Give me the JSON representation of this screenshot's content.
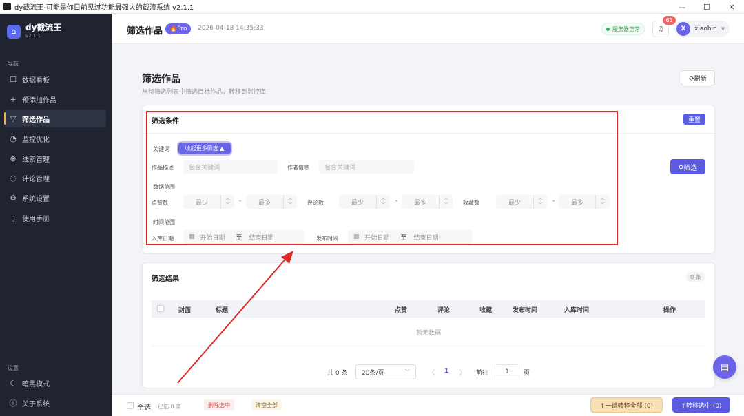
{
  "window": {
    "title": "dy截流王-可能是你目前见过功能最强大的截流系统 v2.1.1",
    "minimize": "—",
    "maximize": "☐",
    "close": "✕"
  },
  "brand": {
    "name": "dy截流王",
    "version": "v2.1.1"
  },
  "sidebar": {
    "nav_label": "导航",
    "items": [
      {
        "label": "数据看板",
        "icon": "chart-icon"
      },
      {
        "label": "预添加作品",
        "icon": "plus-icon"
      },
      {
        "label": "筛选作品",
        "icon": "filter-icon",
        "active": true
      },
      {
        "label": "监控优化",
        "icon": "monitor-icon"
      },
      {
        "label": "线索管理",
        "icon": "target-icon"
      },
      {
        "label": "评论管理",
        "icon": "comment-icon"
      },
      {
        "label": "系统设置",
        "icon": "gear-icon"
      },
      {
        "label": "使用手册",
        "icon": "book-icon"
      }
    ],
    "settings_label": "设置",
    "bottom_items": [
      {
        "label": "暗黑模式",
        "icon": "moon-icon"
      },
      {
        "label": "关于系统",
        "icon": "info-icon"
      }
    ]
  },
  "header": {
    "title": "筛选作品",
    "badge": "🔥Pro",
    "datetime": "2026-04-18 14:35:33",
    "server_status": "服务器正常",
    "notifications": "63",
    "avatar_letter": "X",
    "username": "xiaobin"
  },
  "page": {
    "title": "筛选作品",
    "subtitle": "从待筛选列表中筛选目标作品，转移到监控库",
    "refresh_label": "⟳刷新"
  },
  "filter": {
    "title": "筛选条件",
    "reset_label": "重置",
    "submit_label": "⚲筛选",
    "keyword_label": "关键词",
    "collapse_label": "收起更多筛选 ▲",
    "desc_label": "作品描述",
    "desc_placeholder": "包含关键词",
    "author_label": "作者信息",
    "author_placeholder": "包含关键词",
    "range_label": "数据范围",
    "likes_label": "点赞数",
    "comments_label": "评论数",
    "favorites_label": "收藏数",
    "min_placeholder": "最少",
    "max_placeholder": "最多",
    "dash": "-",
    "time_label": "时间范围",
    "stored_date_label": "入库日期",
    "publish_time_label": "发布时间",
    "start_placeholder": "开始日期",
    "to": "至",
    "end_placeholder": "结束日期"
  },
  "results": {
    "title": "筛选结果",
    "count": "0 条",
    "columns": [
      "封面",
      "标题",
      "点赞",
      "评论",
      "收藏",
      "发布时间",
      "入库时间",
      "操作"
    ],
    "empty_text": "暂无数据"
  },
  "pagination": {
    "total": "共 0 条",
    "page_size": "20条/页",
    "current": "1",
    "goto_label": "前往",
    "goto_value": "1",
    "page_suffix": "页"
  },
  "footer": {
    "select_all": "全选",
    "selected": "已选 0 条",
    "delete_selected": "删除选中",
    "clear_all": "清空全部",
    "move_all": "↑一键转移全部 (0)",
    "move_selected": "↑转移选中 (0)"
  },
  "colors": {
    "accent": "#5b5be0",
    "sidebar_bg": "#1f2430",
    "annotation_red": "#e02a2a"
  }
}
